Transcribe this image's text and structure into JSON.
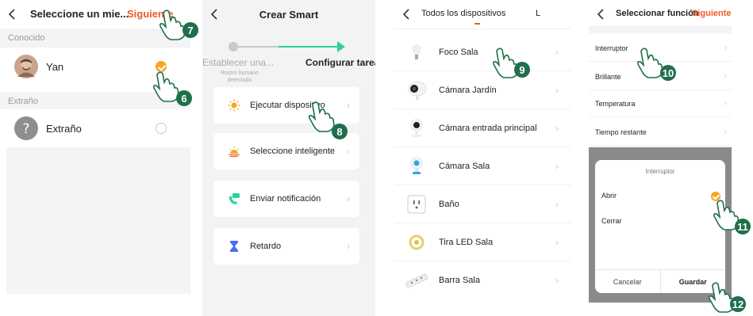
{
  "screen1": {
    "title": "Seleccione un mie...",
    "next": "Siguiente",
    "section_known": "Conocido",
    "user_name": "Yan",
    "section_stranger": "Extraño",
    "stranger_name": "Extraño",
    "step_badges": [
      "7",
      "6"
    ]
  },
  "screen2": {
    "title": "Crear Smart",
    "step_a": "Establecer una...",
    "step_a_sub": "Rostro humano detectado",
    "step_b": "Configurar tarea",
    "cards": [
      {
        "label": "Ejecutar dispositivo",
        "icon": "sun-icon"
      },
      {
        "label": "Seleccione inteligente",
        "icon": "sunrise-icon"
      },
      {
        "label": "Enviar notificación",
        "icon": "phone-message-icon"
      },
      {
        "label": "Retardo",
        "icon": "hourglass-icon"
      }
    ],
    "step_badge": "8"
  },
  "screen3": {
    "title": "Todos los dispositivos",
    "title2": "L",
    "devices": [
      {
        "label": "Foco Sala",
        "icon": "bulb-icon"
      },
      {
        "label": "Cámara Jardín",
        "icon": "camera-icon"
      },
      {
        "label": "Cámara entrada principal",
        "icon": "camera-icon"
      },
      {
        "label": "Cámara Sala",
        "icon": "camera-icon"
      },
      {
        "label": "Baño",
        "icon": "plug-icon"
      },
      {
        "label": "Tira LED Sala",
        "icon": "led-strip-icon"
      },
      {
        "label": "Barra Sala",
        "icon": "power-strip-icon"
      }
    ],
    "step_badge": "9"
  },
  "screen4": {
    "title": "Seleccionar función",
    "next": "Siguiente",
    "functions": [
      "Interruptor",
      "Brillante",
      "Temperatura",
      "Tiempo restante"
    ],
    "dialog": {
      "title": "Interruptor",
      "options": [
        "Abrir",
        "Cerrar"
      ],
      "cancel": "Cancelar",
      "save": "Guardar"
    },
    "step_badges": [
      "10",
      "11",
      "12"
    ]
  },
  "colors": {
    "accent": "#f05a28",
    "check": "#f5a623",
    "progress": "#2ed19b",
    "badge": "#1f6f4a"
  }
}
